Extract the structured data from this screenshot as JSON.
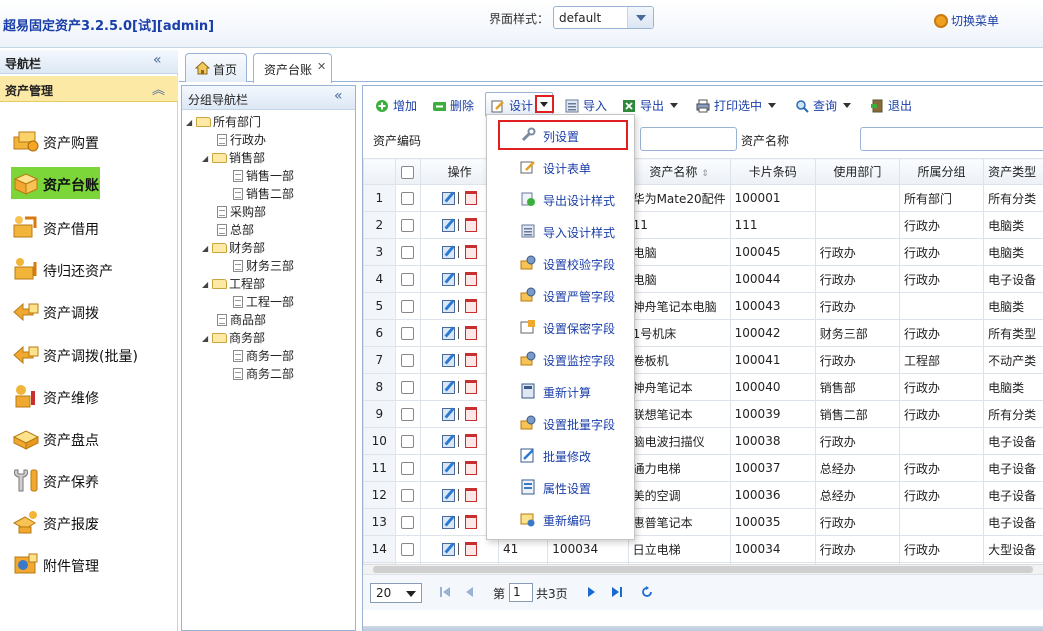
{
  "app": {
    "title": "超易固定资产3.2.5.0[试][admin]"
  },
  "header": {
    "style_label": "界面样式：",
    "style_value": "default",
    "switch_menu": "切换菜单"
  },
  "nav": {
    "title": "导航栏",
    "section": "资产管理",
    "items": [
      {
        "label": "资产购置"
      },
      {
        "label": "资产台账"
      },
      {
        "label": "资产借用"
      },
      {
        "label": "待归还资产"
      },
      {
        "label": "资产调拨"
      },
      {
        "label": "资产调拨(批量)"
      },
      {
        "label": "资产维修"
      },
      {
        "label": "资产盘点"
      },
      {
        "label": "资产保养"
      },
      {
        "label": "资产报废"
      },
      {
        "label": "附件管理"
      }
    ]
  },
  "tabs": [
    {
      "label": "首页"
    },
    {
      "label": "资产台账"
    }
  ],
  "group_nav": {
    "title": "分组导航栏",
    "nodes": [
      {
        "label": "所有部门"
      },
      {
        "label": "行政办"
      },
      {
        "label": "销售部"
      },
      {
        "label": "销售一部"
      },
      {
        "label": "销售二部"
      },
      {
        "label": "采购部"
      },
      {
        "label": "总部"
      },
      {
        "label": "财务部"
      },
      {
        "label": "财务三部"
      },
      {
        "label": "工程部"
      },
      {
        "label": "工程一部"
      },
      {
        "label": "商品部"
      },
      {
        "label": "商务部"
      },
      {
        "label": "商务一部"
      },
      {
        "label": "商务二部"
      }
    ]
  },
  "toolbar": {
    "add": "增加",
    "delete": "删除",
    "design": "设计",
    "import": "导入",
    "export": "导出",
    "print": "打印选中",
    "query": "查询",
    "exit": "退出"
  },
  "search": {
    "code_label": "资产编码",
    "name_label": "资产名称"
  },
  "grid": {
    "headers": {
      "op": "操作",
      "name": "资产名称",
      "card": "卡片条码",
      "dept": "使用部门",
      "group": "所属分组",
      "type": "资产类型"
    },
    "rows": [
      {
        "n": "1",
        "c1": "",
        "c2": "",
        "name": "华为Mate20配件",
        "card": "100001",
        "dept": "",
        "group": "所有部门",
        "type": "所有分类"
      },
      {
        "n": "2",
        "c1": "",
        "c2": "",
        "name": "11",
        "card": "111",
        "dept": "",
        "group": "行政办",
        "type": "电脑类"
      },
      {
        "n": "3",
        "c1": "",
        "c2": "",
        "name": "电脑",
        "card": "100045",
        "dept": "行政办",
        "group": "行政办",
        "type": "电脑类"
      },
      {
        "n": "4",
        "c1": "",
        "c2": "",
        "name": "电脑",
        "card": "100044",
        "dept": "行政办",
        "group": "行政办",
        "type": "电子设备"
      },
      {
        "n": "5",
        "c1": "",
        "c2": "",
        "name": "神舟笔记本电脑",
        "card": "100043",
        "dept": "行政办",
        "group": "",
        "type": "电脑类"
      },
      {
        "n": "6",
        "c1": "",
        "c2": "",
        "name": "1号机床",
        "card": "100042",
        "dept": "财务三部",
        "group": "行政办",
        "type": "所有类型"
      },
      {
        "n": "7",
        "c1": "",
        "c2": "",
        "name": "卷板机",
        "card": "100041",
        "dept": "行政办",
        "group": "工程部",
        "type": "不动产类"
      },
      {
        "n": "8",
        "c1": "",
        "c2": "",
        "name": "神舟笔记本",
        "card": "100040",
        "dept": "销售部",
        "group": "行政办",
        "type": "电脑类"
      },
      {
        "n": "9",
        "c1": "",
        "c2": "",
        "name": "联想笔记本",
        "card": "100039",
        "dept": "销售二部",
        "group": "行政办",
        "type": "所有分类"
      },
      {
        "n": "10",
        "c1": "",
        "c2": "",
        "name": "脑电波扫描仪",
        "card": "100038",
        "dept": "行政办",
        "group": "",
        "type": "电子设备"
      },
      {
        "n": "11",
        "c1": "",
        "c2": "",
        "name": "通力电梯",
        "card": "100037",
        "dept": "总经办",
        "group": "行政办",
        "type": "电子设备"
      },
      {
        "n": "12",
        "c1": "",
        "c2": "",
        "name": "美的空调",
        "card": "100036",
        "dept": "总经办",
        "group": "行政办",
        "type": "电子设备"
      },
      {
        "n": "13",
        "c1": "",
        "c2": "",
        "name": "惠普笔记本",
        "card": "100035",
        "dept": "行政办",
        "group": "",
        "type": "电子设备"
      },
      {
        "n": "14",
        "c1": "41",
        "c2": "100034",
        "name": "日立电梯",
        "card": "100034",
        "dept": "行政办",
        "group": "行政办",
        "type": "大型设备"
      },
      {
        "n": "15",
        "c1": "",
        "c2": "",
        "name": "",
        "card": "",
        "dept": "",
        "group": "",
        "type": ""
      }
    ]
  },
  "pager": {
    "page_size": "20",
    "page_prefix": "第",
    "page_value": "1",
    "page_suffix": "共3页"
  },
  "design_menu": {
    "items": [
      {
        "label": "列设置",
        "icon": "wrench-icon"
      },
      {
        "label": "设计表单",
        "icon": "form-edit-icon"
      },
      {
        "label": "导出设计样式",
        "icon": "export-style-icon"
      },
      {
        "label": "导入设计样式",
        "icon": "import-style-icon"
      },
      {
        "label": "设置校验字段",
        "icon": "gear-field-icon"
      },
      {
        "label": "设置严管字段",
        "icon": "gear-field-icon"
      },
      {
        "label": "设置保密字段",
        "icon": "secret-field-icon"
      },
      {
        "label": "设置监控字段",
        "icon": "gear-field-icon"
      },
      {
        "label": "重新计算",
        "icon": "calculator-icon"
      },
      {
        "label": "设置批量字段",
        "icon": "gear-field-icon"
      },
      {
        "label": "批量修改",
        "icon": "batch-edit-icon"
      },
      {
        "label": "属性设置",
        "icon": "properties-icon"
      },
      {
        "label": "重新编码",
        "icon": "recode-icon"
      }
    ]
  }
}
